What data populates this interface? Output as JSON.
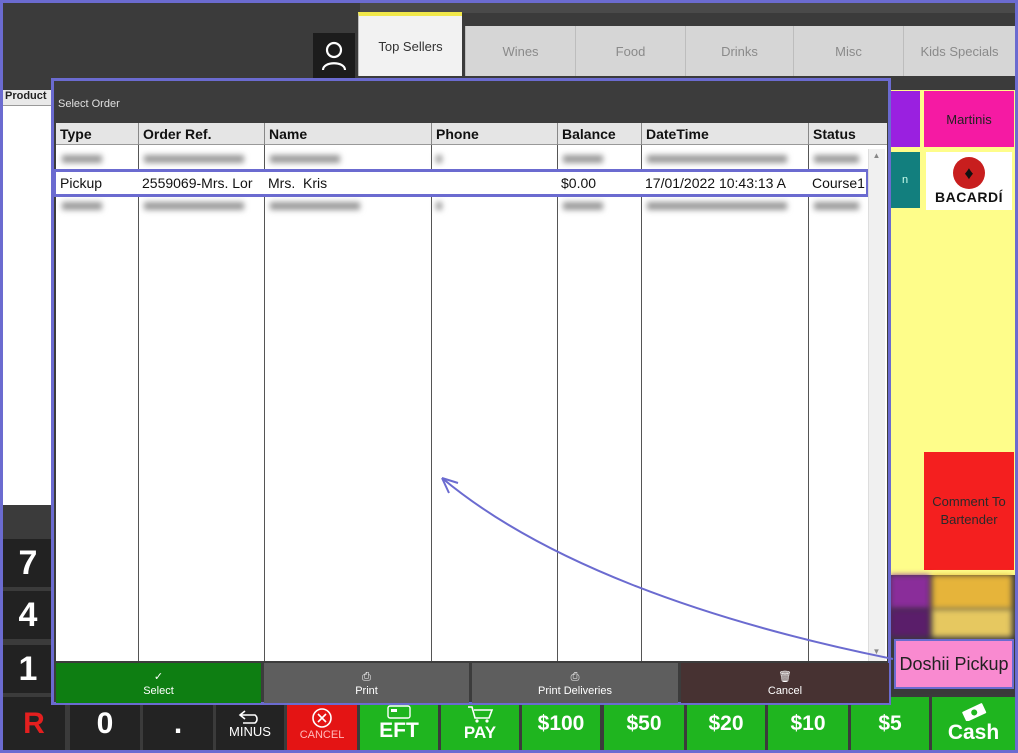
{
  "header": {
    "tabs": [
      {
        "label": "Top Sellers",
        "active": true
      },
      {
        "label": "Wines"
      },
      {
        "label": "Food"
      },
      {
        "label": "Drinks"
      },
      {
        "label": "Misc"
      },
      {
        "label": "Kids Specials"
      }
    ],
    "user_icon": "user-icon"
  },
  "left": {
    "product_header": "Product",
    "keypad": [
      "7",
      "4",
      "1"
    ]
  },
  "right": {
    "martinis": "Martinis",
    "teal_partial": "n",
    "bacardi_text": "BACARDÍ",
    "comment": "Comment To Bartender",
    "doshii": "Doshii Pickup"
  },
  "bottom": {
    "r": "R",
    "zero": "0",
    "dot": ".",
    "minus": "MINUS",
    "cancel": "CANCEL",
    "eft": "EFT",
    "pay": "PAY",
    "d100": "$100",
    "d50": "$50",
    "d20": "$20",
    "d10": "$10",
    "d5": "$5",
    "cash": "Cash"
  },
  "modal": {
    "title": "Select Order",
    "columns": [
      "Type",
      "Order Ref.",
      "Name",
      "Phone",
      "Balance",
      "DateTime",
      "Status"
    ],
    "selected_row": {
      "type": "Pickup",
      "order_ref": "2559069-Mrs. Lor",
      "name": "Mrs.  Kris",
      "phone": "",
      "balance": "$0.00",
      "datetime": "17/01/2022 10:43:13 A",
      "status": "Course1"
    },
    "buttons": {
      "select": "Select",
      "print": "Print",
      "print_deliveries": "Print Deliveries",
      "cancel": "Cancel"
    }
  },
  "colors": {
    "accent_outline": "#6b6bd0",
    "green": "#1fb51f",
    "yellow_panel": "#fefd8a",
    "red": "#f41f1f"
  }
}
